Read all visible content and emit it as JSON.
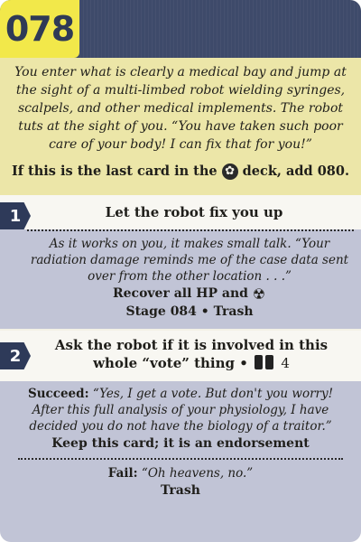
{
  "card": {
    "number": "078"
  },
  "intro": {
    "text": "You enter what is clearly a medical bay and jump at the sight of a multi-limbed robot wielding syringes, scalpels, and other medical implements. The robot tuts at the sight of you. “You have taken such poor care of your body! I can fix that for you!”",
    "rule_prefix": "If this is the last card in the",
    "rule_suffix": "deck, add 080.",
    "deck_icon": "gear-icon"
  },
  "options": [
    {
      "badge": "1",
      "title": "Let the robot fix you up",
      "result": {
        "italic": "As it works on you, it makes small talk. “Your radiation damage reminds me of the case data sent over from the other location . . .”",
        "bold_line_1": "Recover all HP and",
        "bold_line_1_icon": "radiation-icon",
        "bold_line_2": "Stage 084 • Trash"
      }
    },
    {
      "badge": "2",
      "title_part1": "Ask the robot if it is involved in this",
      "title_part2": "whole “vote” thing •",
      "title_icon": "vote-icon",
      "title_number": "4",
      "succeed": {
        "label": "Succeed:",
        "text": "“Yes, I get a vote. But don't you worry! After this full analysis of your physiology, I have decided you do not have the biology of a traitor.”",
        "outcome": "Keep this card; it is an endorsement"
      },
      "fail": {
        "label": "Fail:",
        "text": "“Oh heavens, no.”",
        "outcome": "Trash"
      }
    }
  ],
  "colors": {
    "header": "#3e4a6a",
    "number_bg": "#f2e84a",
    "intro_bg": "#ece6a8",
    "result_bg": "#c1c4d6",
    "badge_bg": "#2e3a59"
  }
}
